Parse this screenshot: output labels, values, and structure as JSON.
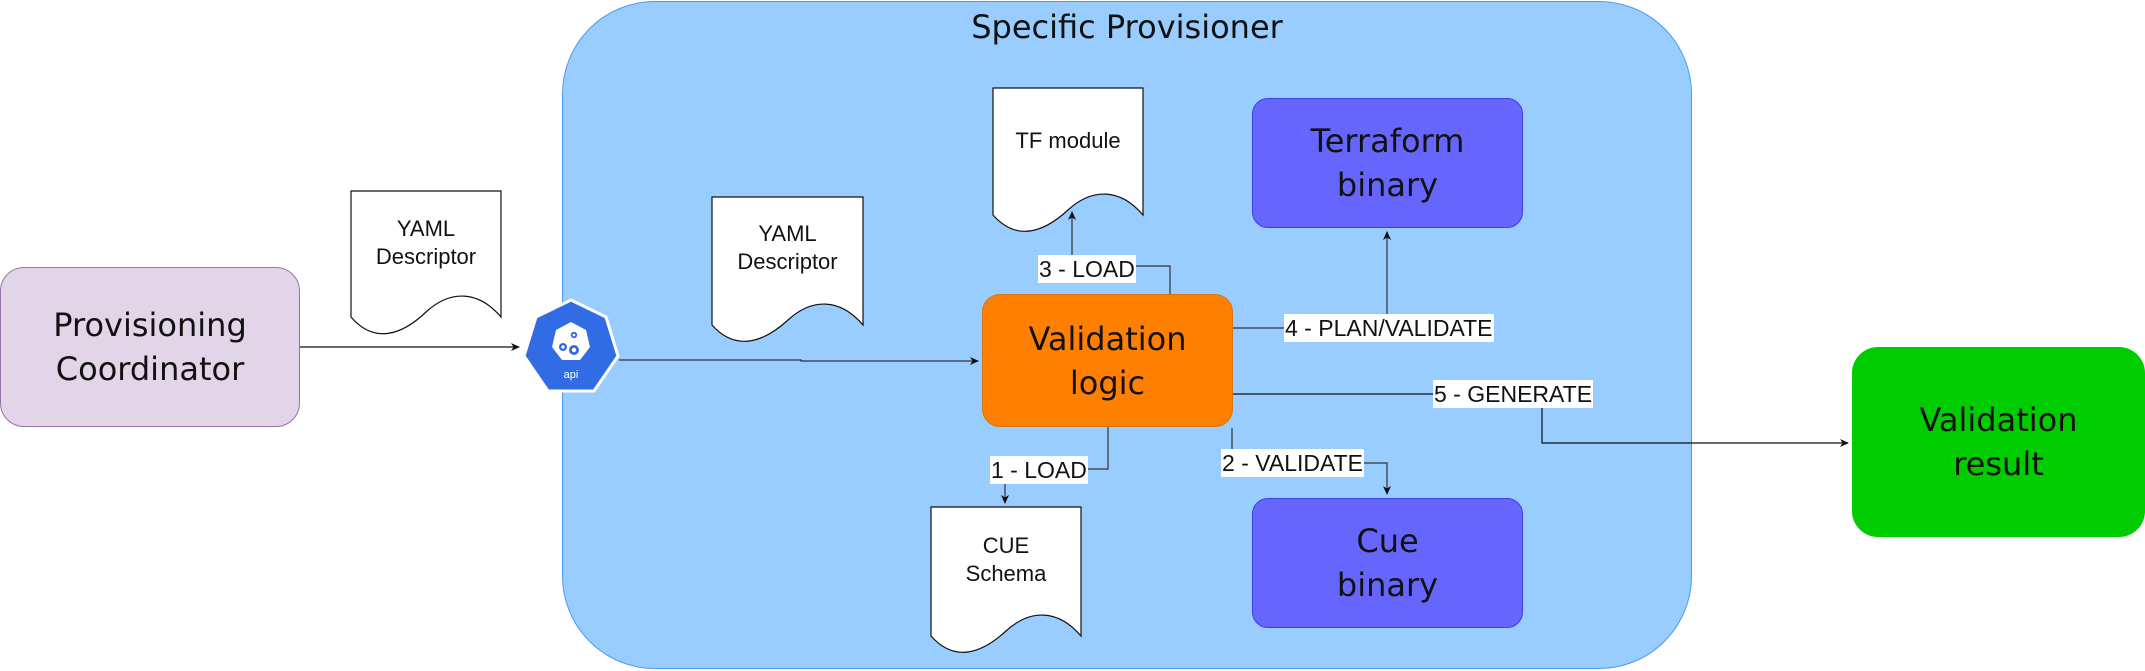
{
  "diagram": {
    "container": {
      "title": "Specific Provisioner"
    },
    "nodes": {
      "coordinator": {
        "line1": "Provisioning",
        "line2": "Coordinator"
      },
      "api_icon": {
        "label": "api"
      },
      "logic": {
        "line1": "Validation",
        "line2": "logic"
      },
      "terraform": {
        "line1": "Terraform",
        "line2": "binary"
      },
      "cue": {
        "line1": "Cue",
        "line2": "binary"
      },
      "result": {
        "line1": "Validation",
        "line2": "result"
      }
    },
    "documents": {
      "yaml_outer": {
        "line1": "YAML",
        "line2": "Descriptor"
      },
      "yaml_inner": {
        "line1": "YAML",
        "line2": "Descriptor"
      },
      "tf_module": {
        "line1": "TF module"
      },
      "cue_schema": {
        "line1": "CUE",
        "line2": "Schema"
      }
    },
    "edge_labels": {
      "load_cue": "1 - LOAD",
      "validate": "2 - VALIDATE",
      "load_tf": "3 - LOAD",
      "plan": "4 - PLAN/VALIDATE",
      "generate": "5 - GENERATE"
    },
    "colors": {
      "container_fill": "#99CCFF",
      "coordinator_fill": "#E1D5E7",
      "logic_fill": "#FF8000",
      "binary_fill": "#6666FF",
      "result_fill": "#00CC00",
      "api_blue": "#326CE5"
    }
  }
}
